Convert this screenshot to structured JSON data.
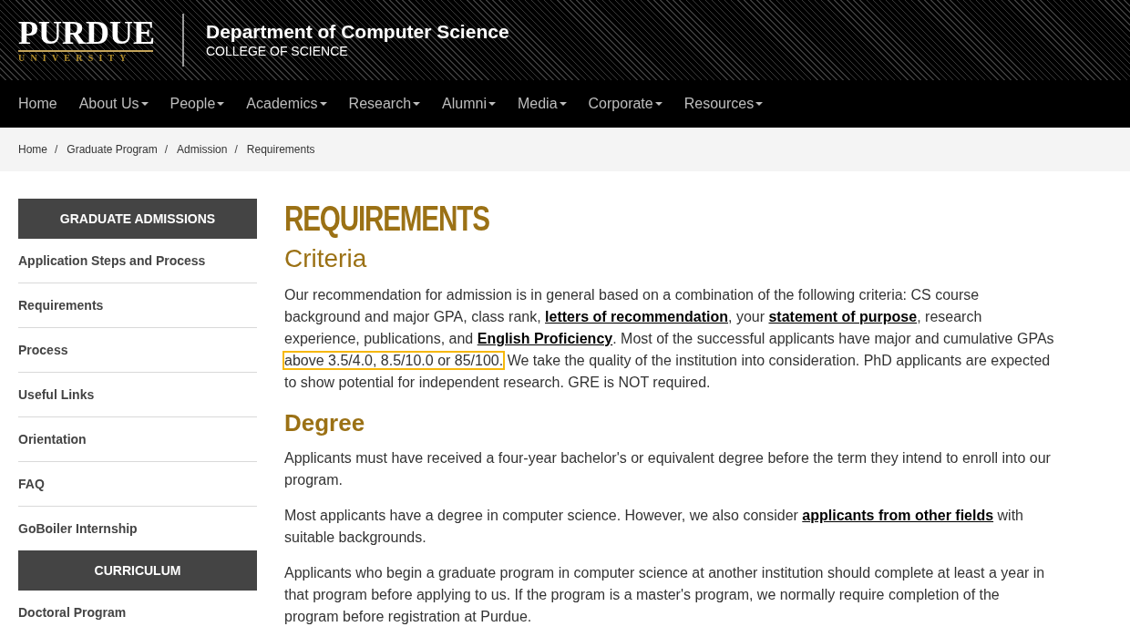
{
  "header": {
    "logo": {
      "wordmark": "PURDUE",
      "subline": "UNIVERSITY"
    },
    "title": "Department of Computer Science",
    "subtitle": "COLLEGE OF SCIENCE"
  },
  "nav": [
    {
      "label": "Home",
      "has_menu": false
    },
    {
      "label": "About Us",
      "has_menu": true
    },
    {
      "label": "People",
      "has_menu": true
    },
    {
      "label": "Academics",
      "has_menu": true
    },
    {
      "label": "Research",
      "has_menu": true
    },
    {
      "label": "Alumni",
      "has_menu": true
    },
    {
      "label": "Media",
      "has_menu": true
    },
    {
      "label": "Corporate",
      "has_menu": true
    },
    {
      "label": "Resources",
      "has_menu": true
    }
  ],
  "breadcrumb": [
    {
      "label": "Home",
      "separator": "/"
    },
    {
      "label": "Graduate Program",
      "separator": "/"
    },
    {
      "label": "Admission",
      "separator": "/"
    },
    {
      "label": "Requirements"
    }
  ],
  "sidebar": [
    {
      "kind": "heading",
      "label": "GRADUATE ADMISSIONS"
    },
    {
      "kind": "link",
      "label": "Application Steps and Process"
    },
    {
      "kind": "link",
      "label": "Requirements"
    },
    {
      "kind": "link",
      "label": "Process"
    },
    {
      "kind": "link",
      "label": "Useful Links"
    },
    {
      "kind": "link",
      "label": "Orientation"
    },
    {
      "kind": "link",
      "label": "FAQ"
    },
    {
      "kind": "link",
      "label": "GoBoiler Internship"
    },
    {
      "kind": "heading",
      "label": "CURRICULUM"
    },
    {
      "kind": "link",
      "label": "Doctoral Program"
    }
  ],
  "page_title": "REQUIREMENTS",
  "sections": [
    {
      "heading": "Criteria",
      "kind": "light",
      "paragraphs": [
        [
          {
            "kind": "plain",
            "text": "Our recommendation for admission is in general based on a combination of the following criteria: CS course background and major GPA, class rank, "
          },
          {
            "kind": "link",
            "text": "letters of recommendation"
          },
          {
            "kind": "plain",
            "text": ", your "
          },
          {
            "kind": "link",
            "text": "statement of purpose"
          },
          {
            "kind": "plain",
            "text": ", research experience, publications, and "
          },
          {
            "kind": "link",
            "text": "English Proficiency"
          },
          {
            "kind": "plain",
            "text": ". Most of the successful applicants have major and cumulative GPAs "
          },
          {
            "kind": "highlight",
            "text": "above 3.5/4.0, 8.5/10.0 or 85/100."
          },
          {
            "kind": "plain",
            "text": " We take the quality of the institution into consideration. PhD applicants are expected to show potential for independent research. GRE is NOT required."
          }
        ]
      ]
    },
    {
      "heading": "Degree",
      "kind": "bold",
      "paragraphs": [
        [
          {
            "kind": "plain",
            "text": "Applicants must have received a four-year bachelor's or equivalent degree before the term they intend to enroll into our program."
          }
        ],
        [
          {
            "kind": "plain",
            "text": "Most applicants have a degree in computer science. However, we also consider "
          },
          {
            "kind": "link",
            "text": "applicants from other fields"
          },
          {
            "kind": "plain",
            "text": " with suitable backgrounds."
          }
        ],
        [
          {
            "kind": "plain",
            "text": "Applicants who begin a graduate program in computer science at another institution should complete at least a year in that program before applying to us. If the program is a master's program, we normally require completion of the program before registration at Purdue."
          }
        ]
      ]
    }
  ]
}
